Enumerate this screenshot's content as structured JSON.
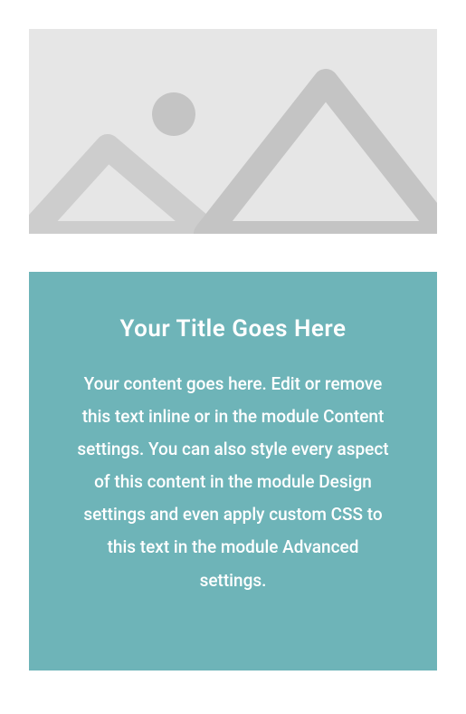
{
  "card": {
    "title": "Your Title Goes Here",
    "body": "Your content goes here. Edit or remove this text inline or in the module Content settings. You can also style every aspect of this content in the module Design settings and even apply custom CSS to this text in the module Advanced settings."
  }
}
